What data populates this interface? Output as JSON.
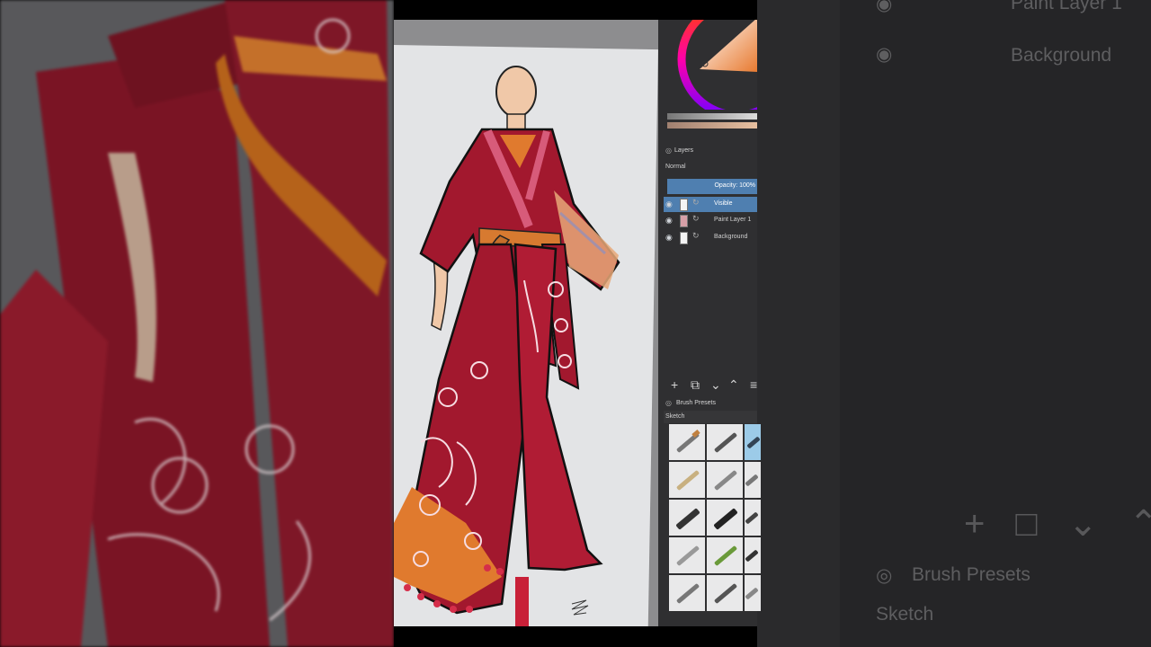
{
  "layers_panel": {
    "title": "Layers",
    "blend_mode": "Normal",
    "opacity_label": "Opacity:  100%",
    "layers": [
      {
        "name": "Visible",
        "active": true
      },
      {
        "name": "Paint Layer 1",
        "active": false
      },
      {
        "name": "Background",
        "active": false
      }
    ]
  },
  "brush_presets": {
    "title": "Brush Presets",
    "tag": "Sketch"
  },
  "background_ghost": {
    "layer_top": "Paint Layer 1",
    "layer_bottom": "Background",
    "brush_title": "Brush Presets",
    "brush_tag": "Sketch"
  },
  "colors": {
    "accent": "#4f7fb0",
    "docker_bg": "#2f2f31",
    "dress_red": "#a2182e",
    "dress_orange": "#e07a2e"
  }
}
